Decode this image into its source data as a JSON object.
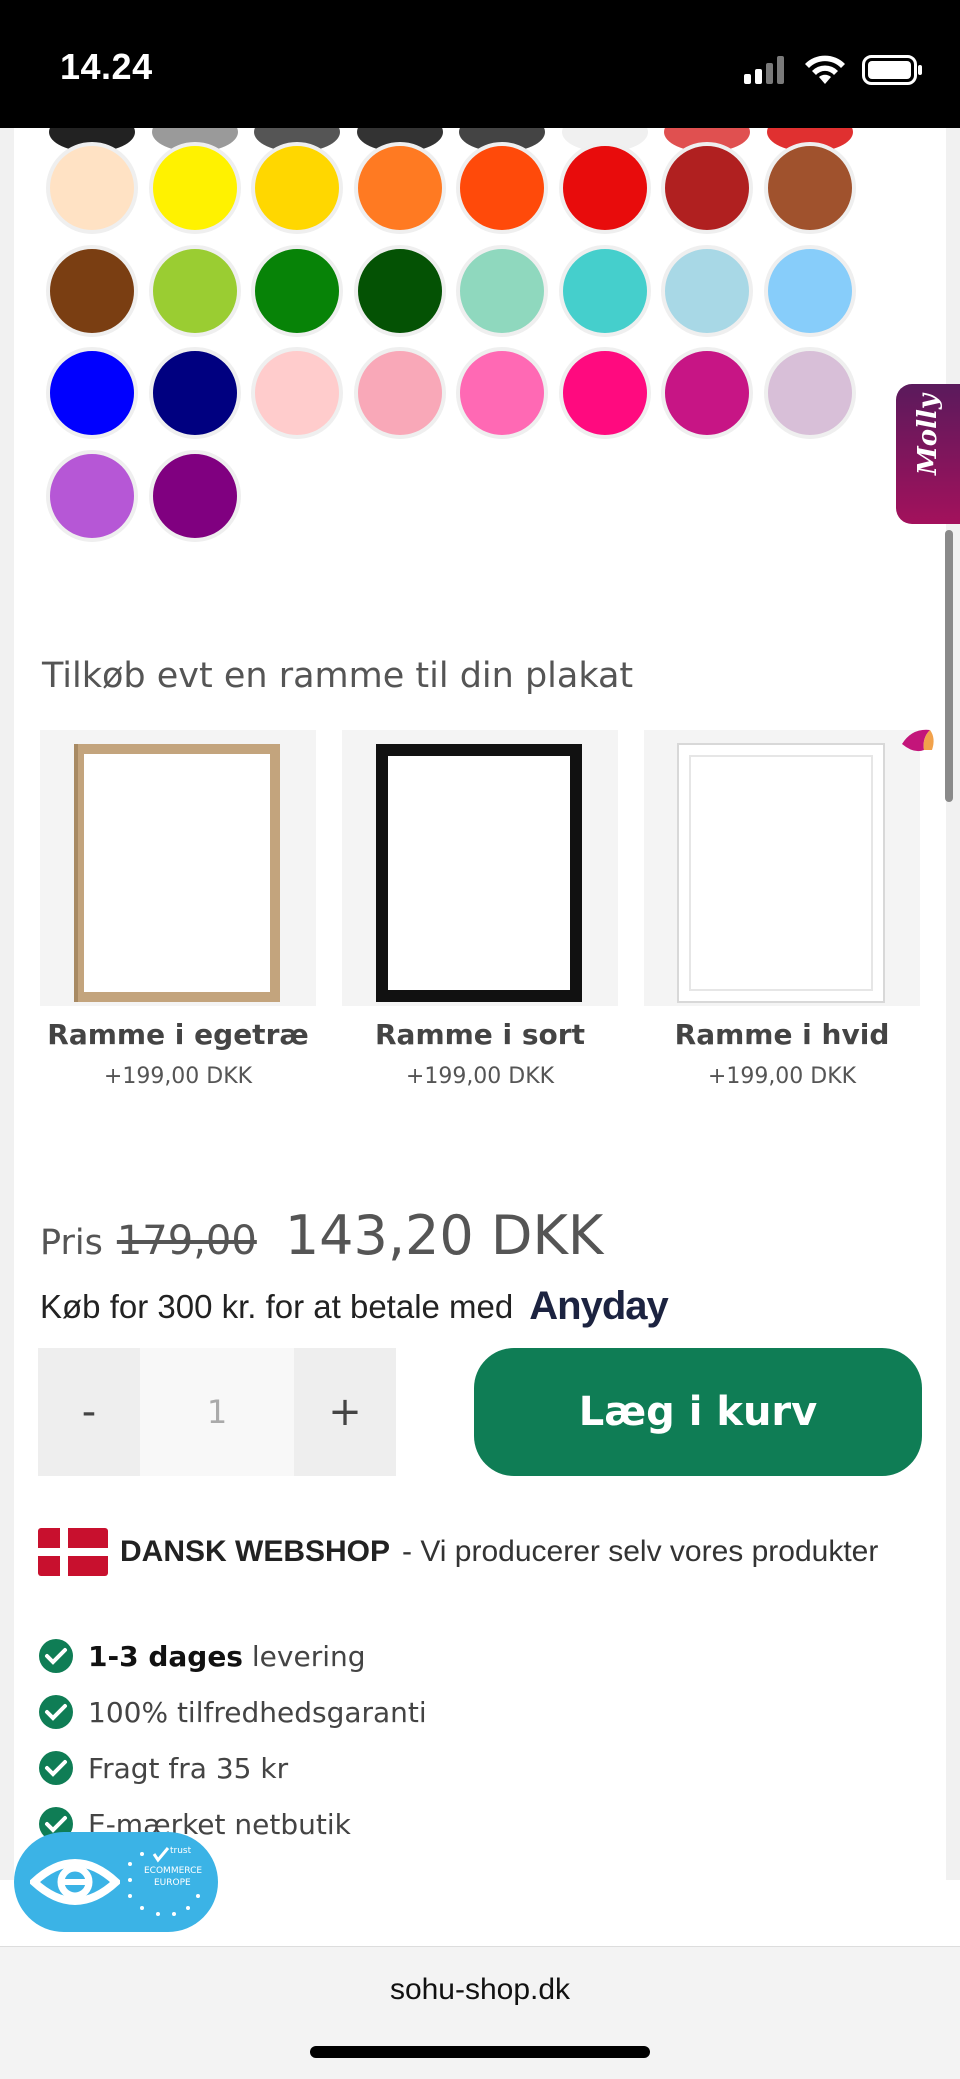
{
  "status_bar": {
    "time": "14.24",
    "icons": [
      "signal-icon",
      "wifi-icon",
      "battery-icon"
    ]
  },
  "color_swatches": {
    "top_row_partial": [
      "#222222",
      "#9a9a9a",
      "#555555",
      "#333333",
      "#444444",
      "#f0f0f0",
      "#e05050",
      "#e03030"
    ],
    "rows": [
      [
        "#ffe2c4",
        "#fff200",
        "#ffd700",
        "#ff7a22",
        "#ff4a0a",
        "#e80c0c",
        "#b02020",
        "#a0522d"
      ],
      [
        "#7a3e12",
        "#9acd32",
        "#078307",
        "#045204",
        "#8fd8be",
        "#45cfcc",
        "#a8d8e6",
        "#87cdfa"
      ],
      [
        "#0000ff",
        "#000080",
        "#ffcccc",
        "#f9a8b8",
        "#ff69b4",
        "#ff0a7f",
        "#c71585",
        "#d8bfd8"
      ],
      [
        "#b657d6",
        "#800080"
      ]
    ]
  },
  "frames_section": {
    "title": "Tilkøb evt en ramme til din plakat",
    "items": [
      {
        "name": "Ramme i egetræ",
        "price": "+199,00 DKK",
        "frame_color": "#c3a47d"
      },
      {
        "name": "Ramme i sort",
        "price": "+199,00 DKK",
        "frame_color": "#111111"
      },
      {
        "name": "Ramme i hvid",
        "price": "+199,00 DKK",
        "frame_color": "#f3f3f3"
      }
    ]
  },
  "price": {
    "label": "Pris",
    "old": "179,00",
    "new": "143,20 DKK"
  },
  "anyday": {
    "text": "Køb for 300 kr. for at betale med",
    "logo": "Anyday"
  },
  "quantity": {
    "minus": "-",
    "value": "1",
    "plus": "+"
  },
  "cart_button": {
    "label": "Læg i kurv",
    "color": "#0f7d55"
  },
  "dansk": {
    "strong": "DANSK WEBSHOP",
    "rest": "- Vi producerer selv vores produkter"
  },
  "usps": [
    {
      "bold": "1-3 dages",
      "text": " levering"
    },
    {
      "bold": "",
      "text": "100% tilfredhedsgaranti"
    },
    {
      "bold": "",
      "text": "Fragt fra 35 kr"
    },
    {
      "bold": "",
      "text": "E-mærket netbutik"
    }
  ],
  "molly_tab": {
    "label": "Molly"
  },
  "emaerket_badge": {
    "trust_text_1": "trust",
    "trust_text_2": "ECOMMERCE",
    "trust_text_3": "EUROPE"
  },
  "browser": {
    "url": "sohu-shop.dk"
  }
}
